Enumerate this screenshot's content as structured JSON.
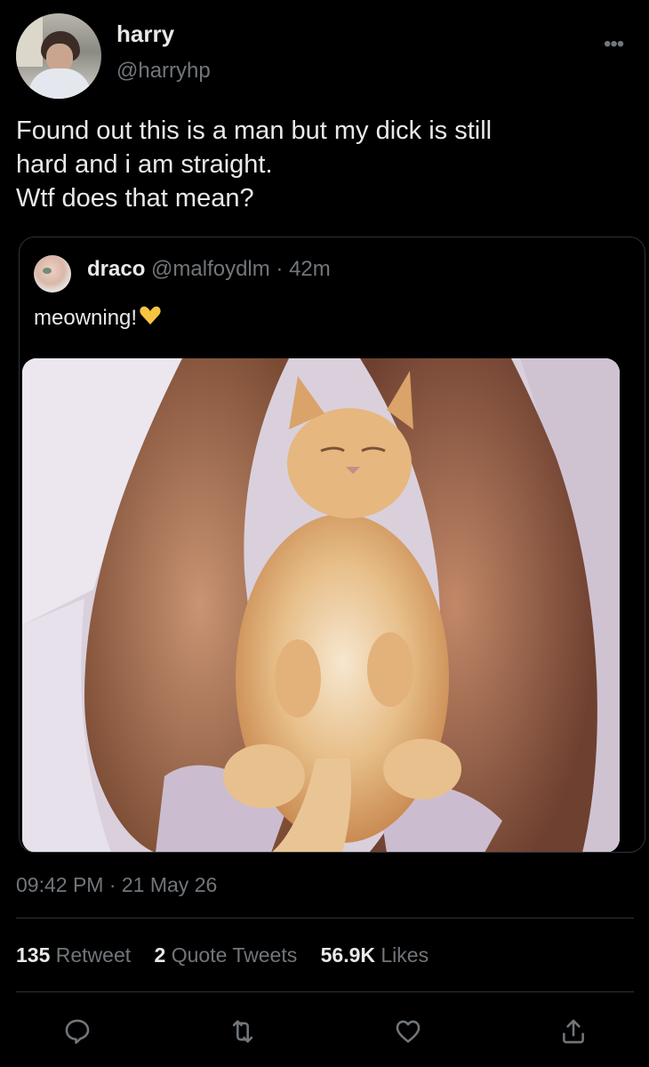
{
  "author": {
    "display_name": "harry",
    "handle": "@harryhp",
    "more_icon": "more-horizontal-icon"
  },
  "tweet": {
    "lines": [
      "Found out this is a man but my dick is still",
      "hard and i am straight.",
      "Wtf does that mean?"
    ],
    "timestamp": "09:42 PM · 21 May 26"
  },
  "quoted": {
    "display_name": "draco",
    "meta": " @malfoydlm · 42m",
    "text": "meowning!",
    "emoji": "yellow-heart"
  },
  "stats": [
    {
      "count": "135",
      "label": "Retweet"
    },
    {
      "count": "2",
      "label": "Quote Tweets"
    },
    {
      "count": "56.9K",
      "label": "Likes"
    }
  ],
  "actions": [
    "reply-icon",
    "retweet-icon",
    "like-icon",
    "share-icon"
  ],
  "colors": {
    "background": "#000000",
    "text": "#e7e9ea",
    "secondary": "#71767b",
    "border": "#2f3336",
    "heart_emoji": "#f5c542"
  }
}
